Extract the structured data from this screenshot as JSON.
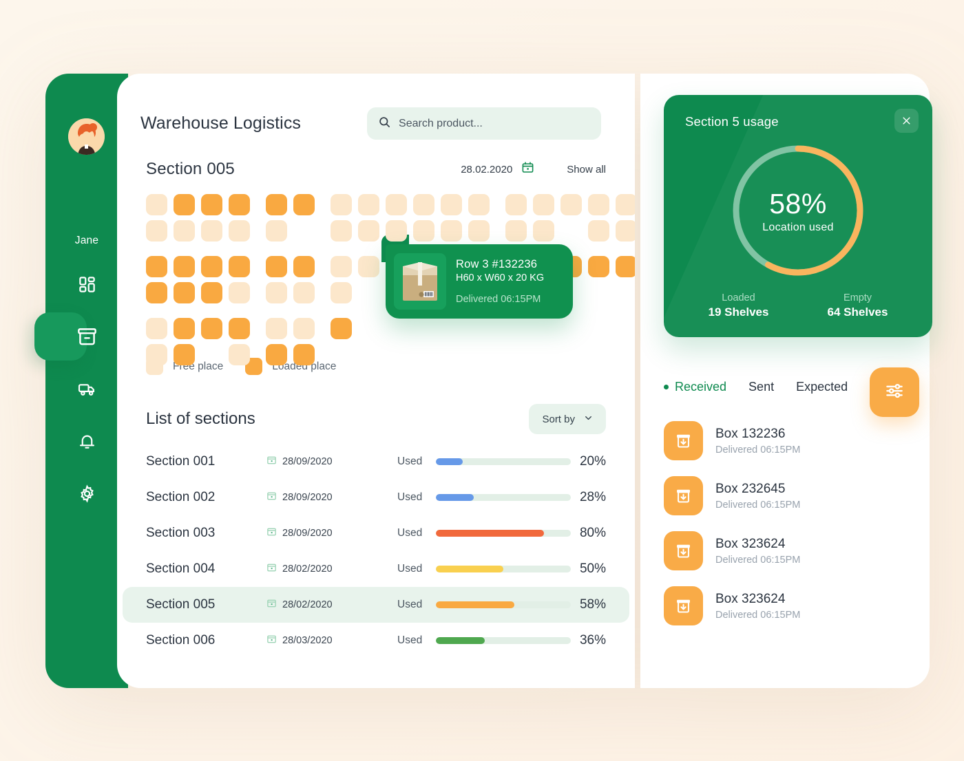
{
  "sidebar": {
    "user_name": "Jane",
    "items": [
      {
        "icon": "dashboard-grid-icon",
        "active": false
      },
      {
        "icon": "archive-box-icon",
        "active": true
      },
      {
        "icon": "truck-icon",
        "active": false
      },
      {
        "icon": "bell-icon",
        "active": false
      },
      {
        "icon": "gear-icon",
        "active": false
      }
    ]
  },
  "header": {
    "title": "Warehouse Logistics",
    "search": {
      "value": "",
      "placeholder": "Search product...",
      "icon": "search-icon"
    }
  },
  "section": {
    "title": "Section 005",
    "date": "28.02.2020",
    "calendar_icon": "calendar-icon",
    "show_all": "Show all"
  },
  "grid": {
    "legend": [
      {
        "label": "Free place",
        "color": "#fce7cb",
        "state": "free"
      },
      {
        "label": "Loaded place",
        "color": "#f9a941",
        "state": "loaded"
      }
    ],
    "rows": [
      [
        "free",
        "loaded",
        "loaded",
        "loaded",
        "sp",
        "loaded",
        "loaded",
        "free",
        "free",
        "sp",
        "free",
        "free",
        "free",
        "free",
        "free",
        "free",
        "sp",
        "free",
        "free",
        "free"
      ],
      [
        "free",
        "free",
        "free",
        "free",
        "sp",
        "free",
        "empty",
        "free",
        "free",
        "sp",
        "free",
        "free",
        "free",
        "free",
        "free",
        "free",
        "sp",
        "empty",
        "free",
        "free"
      ],
      [
        "loaded",
        "loaded",
        "loaded",
        "loaded",
        "sp",
        "loaded",
        "loaded",
        "free",
        "free",
        "sp",
        "free",
        "free",
        "loaded",
        "free",
        "free",
        "loaded",
        "sp",
        "loaded",
        "loaded",
        "loaded"
      ],
      [
        "loaded",
        "loaded",
        "loaded",
        "free",
        "sp",
        "free",
        "free",
        "free",
        "empty",
        "sp",
        "empty",
        "free",
        "free",
        "empty",
        "empty",
        "empty",
        "sp",
        "empty",
        "empty",
        "empty"
      ],
      [
        "free",
        "loaded",
        "loaded",
        "loaded",
        "sp",
        "free",
        "free",
        "loaded",
        "empty",
        "sp",
        "empty",
        "empty",
        "empty",
        "empty",
        "empty",
        "empty",
        "sp",
        "empty",
        "empty",
        "empty"
      ],
      [
        "free",
        "loaded",
        "empty",
        "free",
        "sp",
        "loaded",
        "loaded",
        "empty",
        "empty",
        "sp",
        "empty",
        "empty",
        "empty",
        "empty",
        "empty",
        "empty",
        "sp",
        "empty",
        "empty",
        "empty"
      ]
    ]
  },
  "popup": {
    "title": "Row 3 #132236",
    "dimensions": "H60 x W60 x 20 KG",
    "status": "Delivered 06:15PM",
    "image_icon": "cardboard-box-image"
  },
  "list": {
    "title": "List of sections",
    "sort_label": "Sort by",
    "sort_icon": "chevron-down-icon",
    "used_label": "Used",
    "calendar_icon": "calendar-icon",
    "rows": [
      {
        "name": "Section 001",
        "date": "28/09/2020",
        "used": "Used",
        "percent": 20,
        "percent_label": "20%",
        "color": "#6699e8",
        "active": false
      },
      {
        "name": "Section 002",
        "date": "28/09/2020",
        "used": "Used",
        "percent": 28,
        "percent_label": "28%",
        "color": "#6699e8",
        "active": false
      },
      {
        "name": "Section 003",
        "date": "28/09/2020",
        "used": "Used",
        "percent": 80,
        "percent_label": "80%",
        "color": "#f1693c",
        "active": false
      },
      {
        "name": "Section 004",
        "date": "28/02/2020",
        "used": "Used",
        "percent": 50,
        "percent_label": "50%",
        "color": "#f9d04f",
        "active": false
      },
      {
        "name": "Section 005",
        "date": "28/02/2020",
        "used": "Used",
        "percent": 58,
        "percent_label": "58%",
        "color": "#f9a941",
        "active": true
      },
      {
        "name": "Section 006",
        "date": "28/03/2020",
        "used": "Used",
        "percent": 36,
        "percent_label": "36%",
        "color": "#4fa84f",
        "active": false
      }
    ]
  },
  "usage": {
    "title": "Section 5 usage",
    "close_icon": "close-icon",
    "percent": 58,
    "percent_label": "58%",
    "center_label": "Location used",
    "track_color": "#7cc2a0",
    "arc_color": "#f9b257",
    "stats": [
      {
        "label": "Loaded",
        "value": "19 Shelves"
      },
      {
        "label": "Empty",
        "value": "64 Shelves"
      }
    ]
  },
  "deliveries": {
    "tabs": [
      {
        "label": "Received",
        "active": true
      },
      {
        "label": "Sent",
        "active": false
      },
      {
        "label": "Expected",
        "active": false
      }
    ],
    "filter_icon": "sliders-filter-icon",
    "items": [
      {
        "name": "Box 132236",
        "status": "Delivered 06:15PM",
        "icon": "box-download-icon"
      },
      {
        "name": "Box 232645",
        "status": "Delivered 06:15PM",
        "icon": "box-download-icon"
      },
      {
        "name": "Box 323624",
        "status": "Delivered 06:15PM",
        "icon": "box-download-icon"
      },
      {
        "name": "Box 323624",
        "status": "Delivered 06:15PM",
        "icon": "box-download-icon"
      }
    ]
  }
}
